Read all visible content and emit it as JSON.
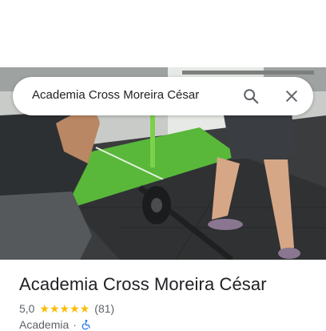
{
  "search": {
    "value": "Academia Cross Moreira César",
    "search_icon": "search-icon",
    "close_icon": "close-icon"
  },
  "place": {
    "name": "Academia Cross Moreira César",
    "rating": "5,0",
    "stars": 5,
    "reviews": "(81)",
    "category": "Academia",
    "separator": "·",
    "accessibility_icon": "wheelchair-icon"
  },
  "colors": {
    "star": "#fbbc04",
    "accessibility": "#1a73e8",
    "turf": "#59b83a"
  }
}
